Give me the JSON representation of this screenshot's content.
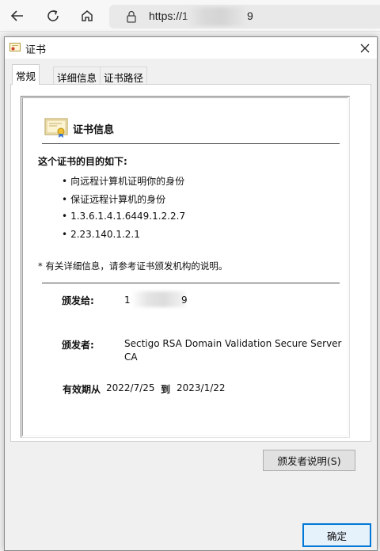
{
  "browser": {
    "url_prefix": "https://1",
    "url_suffix": "9"
  },
  "dialog": {
    "title": "证书",
    "tabs": [
      {
        "label": "常规",
        "active": true
      },
      {
        "label": "详细信息",
        "active": false
      },
      {
        "label": "证书路径",
        "active": false
      }
    ],
    "info_title": "证书信息",
    "purpose_heading": "这个证书的目的如下:",
    "purposes": [
      "向远程计算机证明你的身份",
      "保证远程计算机的身份",
      "1.3.6.1.4.1.6449.1.2.2.7",
      "2.23.140.1.2.1"
    ],
    "note": "* 有关详细信息，请参考证书颁发机构的说明。",
    "issued_to_label": "颁发给:",
    "issued_to_prefix": "1",
    "issued_to_suffix": "9",
    "issued_by_label": "颁发者:",
    "issued_by_value": "Sectigo RSA Domain Validation Secure Server CA",
    "validity_label": "有效期从",
    "valid_from": "2022/7/25",
    "validity_to_label": "到",
    "valid_to": "2023/1/22",
    "issuer_statement_button": "颁发者说明(S)",
    "ok_button": "确定"
  },
  "colors": {
    "accent": "#0078d7",
    "dialog_bg": "#f0f0f0"
  }
}
